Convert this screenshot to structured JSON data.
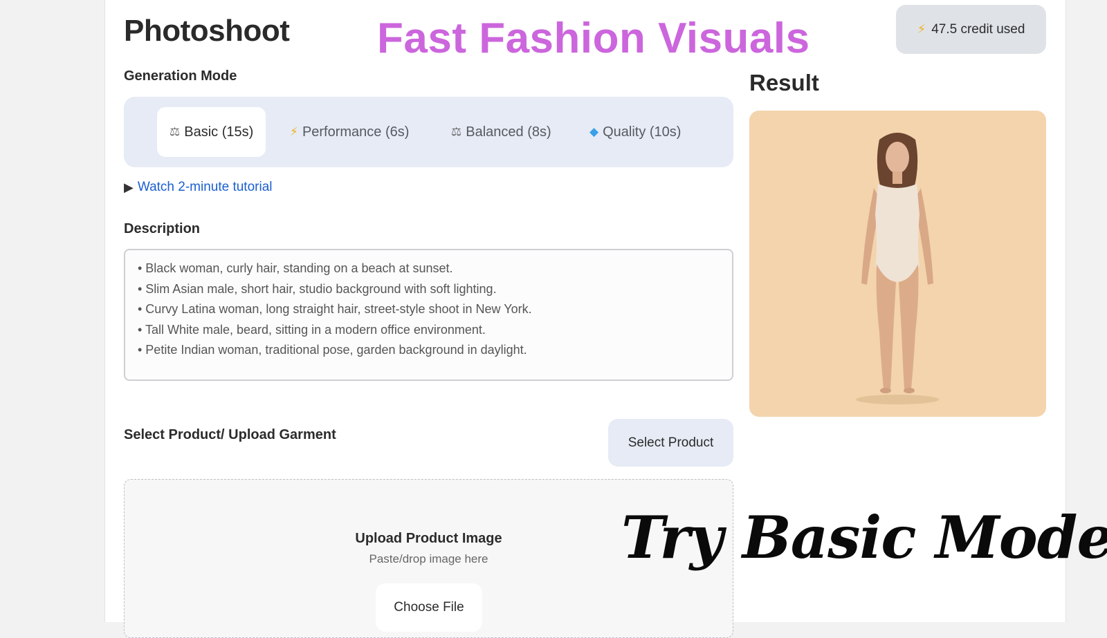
{
  "header": {
    "title": "Photoshoot",
    "overlay_title": "Fast Fashion Visuals",
    "credit": {
      "icon": "bolt-icon",
      "label": "47.5 credit used"
    }
  },
  "generation_mode": {
    "label": "Generation Mode",
    "tabs": [
      {
        "label": "Basic (15s)",
        "icon": "scale-icon",
        "active": true
      },
      {
        "label": "Performance (6s)",
        "icon": "bolt-icon",
        "active": false
      },
      {
        "label": "Balanced (8s)",
        "icon": "scale-icon",
        "active": false
      },
      {
        "label": "Quality (10s)",
        "icon": "gem-icon",
        "active": false
      }
    ]
  },
  "tutorial": {
    "icon": "video-camera-icon",
    "label": "Watch 2-minute tutorial"
  },
  "description": {
    "label": "Description",
    "lines": [
      "• Black woman, curly hair, standing on a beach at sunset.",
      "• Slim Asian male, short hair, studio background with soft lighting.",
      "• Curvy Latina woman, long straight hair, street-style shoot in New York.",
      "• Tall White male, beard, sitting in a modern office environment.",
      "• Petite Indian woman, traditional pose, garden background in daylight."
    ]
  },
  "product": {
    "label": "Select Product/ Upload Garment",
    "select_button": "Select Product",
    "upload_title": "Upload Product Image",
    "upload_hint": "Paste/drop image here",
    "choose_file": "Choose File"
  },
  "result": {
    "title": "Result",
    "background_color": "#f3d4ac"
  },
  "overlay_cta": "Try Basic Mode",
  "colors": {
    "accent_title": "#cc66dd",
    "link": "#1a5fd0",
    "mode_bar": "#e6ebf5",
    "credit_badge": "#dfe3e8"
  }
}
